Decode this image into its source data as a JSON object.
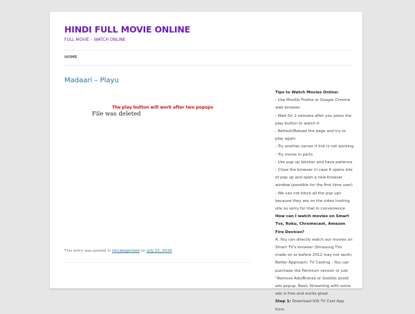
{
  "site": {
    "title": "HINDI FULL MOVIE ONLINE",
    "description": "FULL MOVIE – WATCH ONLINE"
  },
  "nav": {
    "home": "HOME"
  },
  "post": {
    "title": "Madaari – Playu",
    "notice": "The play button will work after two popups",
    "player_message": "File was deleted",
    "meta_prefix": "This entry was posted in ",
    "category": "Uncategorized",
    "meta_mid": " on ",
    "date": "July 22, 2016",
    "meta_suffix": "."
  },
  "sidebar": {
    "tips_heading": "Tips to Watch Movies Online:",
    "tips": [
      "- Use Mozilla Firefox or Google Chrome web browser",
      "- Wait for 2 minutes after you press the play button to watch it",
      "- Refresh/Reload the page and try to play again",
      "- Try another server if link is not working",
      "- Try movie in parts",
      "- Use pop up blocker and have patience",
      "- Close the browser in case it opens lots of pop up and open a new browser window (possible for the first time user)",
      "- We can not block all the pop ups because they are on the video hosting site so sorry for that in convenience"
    ],
    "faq_heading": "How can I watch movies on Smart Tvs, Roku, Chromecast, Amazon Fire Devices?",
    "faq_answer": "A. You can directly watch our movies on Smart TV's browser (Smasung TVs made on or before 2012 may not work). Better Approach: TV Casting : You can purchase the Permium version or just \"Remove Ads(Bronze or Gold)to avoid ads popup. Basic Streaming with some ads is free and works great.",
    "step1_label": "Step 1:",
    "step1_text": " Download IOS TV Cast App from"
  }
}
